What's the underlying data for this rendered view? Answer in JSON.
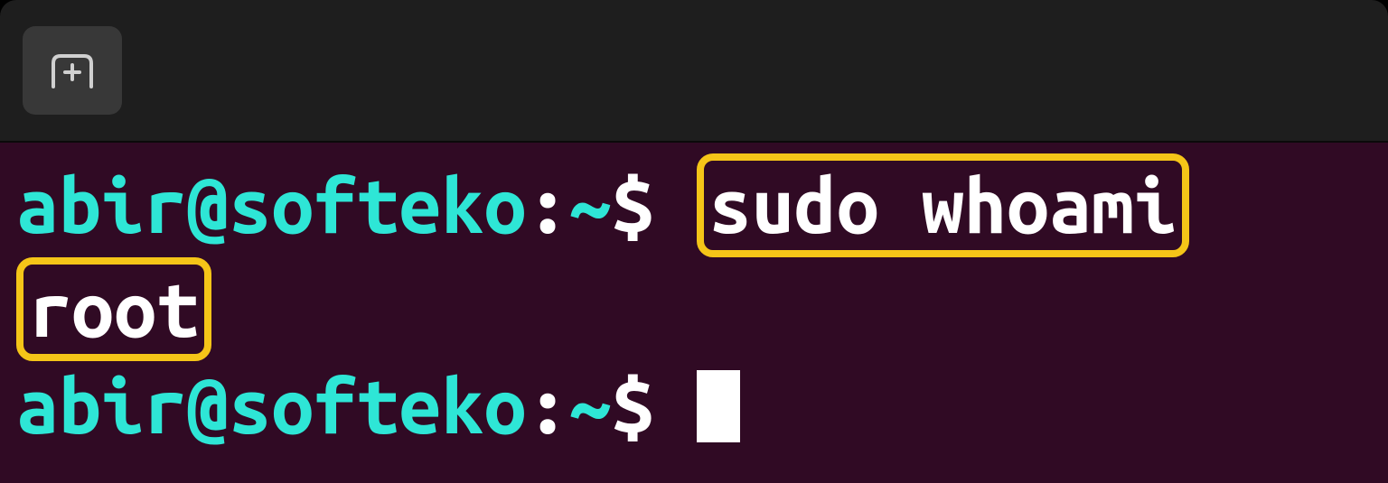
{
  "tabbar": {
    "new_tab_label": "New Tab"
  },
  "terminal": {
    "lines": [
      {
        "prompt_userhost": "abir@softeko",
        "prompt_colon": ":",
        "prompt_path": "~",
        "prompt_symbol": "$",
        "command": "sudo whoami"
      },
      {
        "output": "root"
      },
      {
        "prompt_userhost": "abir@softeko",
        "prompt_colon": ":",
        "prompt_path": "~",
        "prompt_symbol": "$",
        "command": ""
      }
    ]
  },
  "colors": {
    "terminal_bg": "#300a24",
    "tabbar_bg": "#1e1e1e",
    "prompt_cyan": "#2ee6d6",
    "text_white": "#ffffff",
    "highlight_yellow": "#f5c518"
  }
}
